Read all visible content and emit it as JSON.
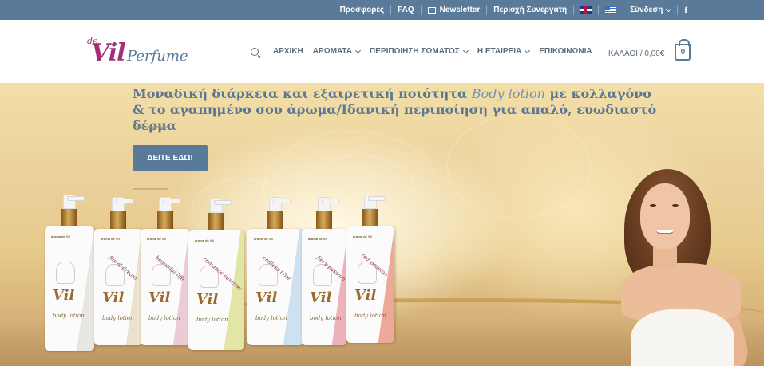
{
  "topbar": {
    "offers": "Προσφορές",
    "faq": "FAQ",
    "newsletter": "Newsletter",
    "partner_area": "Περιοχή Συνεργάτη",
    "login": "Σύνδεση",
    "facebook": "f"
  },
  "logo": {
    "de": "de",
    "vil": "Vil",
    "perfume": "Perfume"
  },
  "nav": {
    "items": [
      {
        "label": "ΑΡΧΙΚΗ"
      },
      {
        "label": "ΑΡΩΜΑΤΑ"
      },
      {
        "label": "ΠΕΡΙΠΟΙΗΣΗ ΣΩΜΑΤΟΣ"
      },
      {
        "label": "Η ΕΤΑΙΡΕΙΑ"
      },
      {
        "label": "ΕΠΙΚΟΙΝΩΝΙΑ"
      }
    ]
  },
  "cart": {
    "label": "ΚΑΛΑΘΙ / 0,00€",
    "count": "0"
  },
  "hero": {
    "headline_part1": "Μοναδική διάρκεια και εξαιρετική ποιότητα ",
    "headline_script": "Body lotion",
    "headline_part2": " με κολλαγόνο & το αγαπημένο σου άρωμα/Ιδανική περιποίηση για απαλό, ευωδιαστό δέρμα",
    "cta": "ΔΕΙΤΕ ΕΔΩ!"
  },
  "bottles": [
    {
      "name": "",
      "tint": "#e6e3de"
    },
    {
      "name": "floral dream",
      "tint": "#e8dfc6"
    },
    {
      "name": "beautiful life",
      "tint": "#eac6cf"
    },
    {
      "name": "romance summer",
      "tint": "#dfe29a"
    },
    {
      "name": "endless blue",
      "tint": "#c9def0"
    },
    {
      "name": "fiery passion",
      "tint": "#ecaab2"
    },
    {
      "name": "red passion",
      "tint": "#ec9e8e"
    }
  ],
  "bottle_texts": {
    "brand_mark": "Vil",
    "sub": "body lotion",
    "label": "aroma de Vil"
  },
  "colors": {
    "topbar": "#5a7a99",
    "brand_pink": "#a52f74",
    "brand_blue": "#5a7a99",
    "nav_text": "#5b6c7d"
  }
}
